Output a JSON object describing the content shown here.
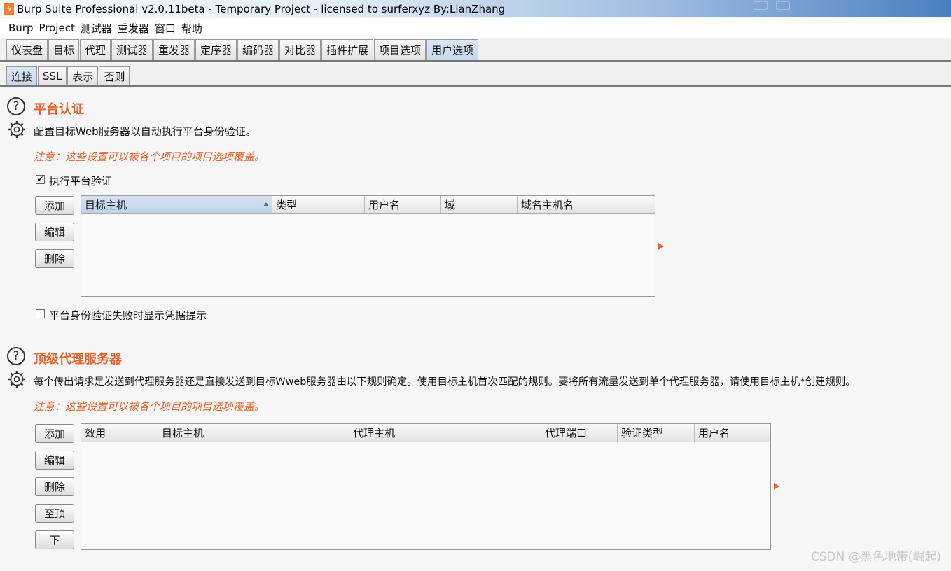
{
  "window": {
    "title": "Burp Suite Professional v2.0.11beta - Temporary Project - licensed to surferxyz By:LianZhang"
  },
  "menubar": {
    "items": [
      "Burp",
      "Project",
      "测试器",
      "重发器",
      "窗口",
      "帮助"
    ]
  },
  "main_tabs": {
    "items": [
      "仪表盘",
      "目标",
      "代理",
      "测试器",
      "重发器",
      "定序器",
      "编码器",
      "对比器",
      "插件扩展",
      "项目选项",
      "用户选项"
    ],
    "active": "用户选项"
  },
  "sub_tabs": {
    "items": [
      "连接",
      "SSL",
      "表示",
      "否则"
    ],
    "active": "连接"
  },
  "platform_auth": {
    "title": "平台认证",
    "description": "配置目标Web服务器以自动执行平台身份验证。",
    "note": "注意：这些设置可以被各个项目的项目选项覆盖。",
    "enable_checkbox": {
      "label": "执行平台验证",
      "checked": true
    },
    "buttons": {
      "add": "添加",
      "edit": "编辑",
      "remove": "删除"
    },
    "table_columns": [
      "目标主机",
      "类型",
      "用户名",
      "域",
      "域名主机名"
    ],
    "sorted_column": "目标主机",
    "rows": [],
    "prompt_checkbox": {
      "label": "平台身份验证失败时显示凭据提示",
      "checked": false
    }
  },
  "upstream_proxy": {
    "title": "顶级代理服务器",
    "description": "每个传出请求是发送到代理服务器还是直接发送到目标Wweb服务器由以下规则确定。使用目标主机首次匹配的规则。要将所有流量发送到单个代理服务器，请使用目标主机*创建规则。",
    "note": "注意：这些设置可以被各个项目的项目选项覆盖。",
    "buttons": {
      "add": "添加",
      "edit": "编辑",
      "remove": "删除",
      "up": "至顶",
      "down": "下"
    },
    "table_columns": [
      "效用",
      "目标主机",
      "代理主机",
      "代理端口",
      "验证类型",
      "用户名"
    ],
    "rows": []
  },
  "watermark": "CSDN @黑色地带(崛起)",
  "colors": {
    "accent": "#e8622c",
    "active_tab": "#c7d8ec",
    "sorted_header": "#bed2ea"
  },
  "icons": {
    "help": "question-circle",
    "settings": "gear",
    "expand": "triangle-right"
  }
}
